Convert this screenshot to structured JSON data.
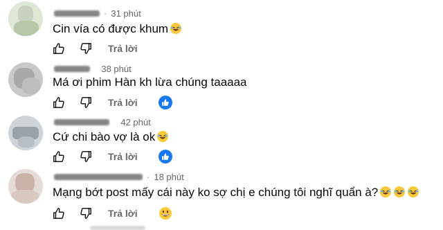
{
  "actions": {
    "like_label": "like",
    "dislike_label": "dislike",
    "reply_label": "Trả lời"
  },
  "comments": [
    {
      "time": "31 phút",
      "text": "Cin vía có được khum",
      "text_emojis": [
        "rofl"
      ],
      "reaction": null,
      "avatar_color": "#dfe7d6"
    },
    {
      "time": "38 phút",
      "text": "Má ơi phim Hàn kh lừa chúng taaaaa",
      "text_emojis": [],
      "reaction": "like",
      "avatar_color": "#c9c9c9"
    },
    {
      "time": "42 phút",
      "text": "Cứ chi bào vợ là ok",
      "text_emojis": [
        "rofl"
      ],
      "reaction": "like",
      "avatar_color": "#cfd4d8"
    },
    {
      "time": "18 phút",
      "text": "Mạng bớt post mấy cái này ko sợ chị e chúng tôi nghĩ quẩn à?",
      "text_emojis": [
        "rofl",
        "rofl",
        "rofl"
      ],
      "reaction": "grin",
      "avatar_color": "#e6dcd7"
    }
  ],
  "colors": {
    "like_blue": "#1877f2",
    "muted": "#65676b",
    "emoji_yellow": "#fbc93d"
  }
}
